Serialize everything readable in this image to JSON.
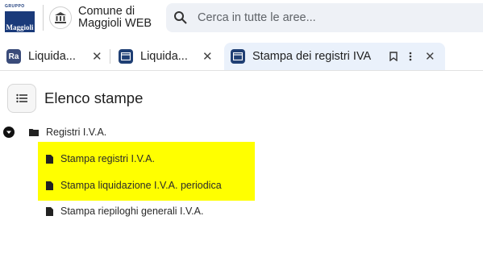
{
  "header": {
    "logo_top_text": "GRUPPO",
    "logo_text": "Maggioli",
    "org_name_line1": "Comune di",
    "org_name_line2": "Maggioli WEB",
    "search_placeholder": "Cerca in tutte le aree..."
  },
  "tabs": [
    {
      "icon_text": "Ra",
      "label": "Liquida...",
      "close": "✕",
      "active": false
    },
    {
      "icon_text": "",
      "label": "Liquida...",
      "close": "✕",
      "active": false
    },
    {
      "icon_text": "",
      "label": "Stampa dei registri IVA",
      "close": "✕",
      "active": true
    }
  ],
  "page": {
    "title": "Elenco stampe"
  },
  "tree": {
    "root_label": "Registri I.V.A.",
    "children": [
      {
        "label": "Stampa registri I.V.A.",
        "highlighted": true
      },
      {
        "label": "Stampa liquidazione I.V.A. periodica",
        "highlighted": true
      },
      {
        "label": "Stampa riepiloghi generali I.V.A.",
        "highlighted": false
      }
    ]
  },
  "colors": {
    "accent": "#1f3f74",
    "active_tab_bg": "#eaf1fb",
    "highlight": "#ffff00"
  }
}
